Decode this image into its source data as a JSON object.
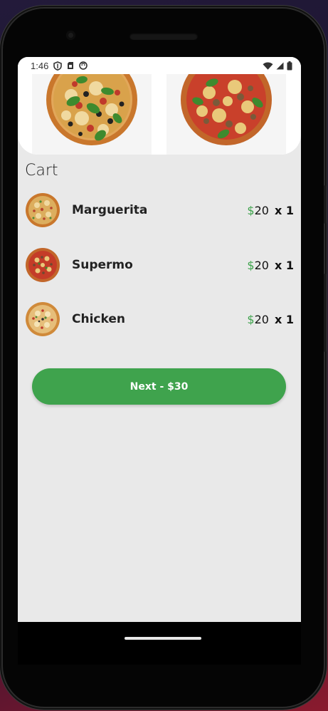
{
  "status_bar": {
    "time": "1:46"
  },
  "cart": {
    "title": "Cart",
    "items": [
      {
        "name": "Marguerita",
        "currency": "$",
        "price": "20",
        "quantity": "x 1"
      },
      {
        "name": "Supermo",
        "currency": "$",
        "price": "20",
        "quantity": "x 1"
      },
      {
        "name": "Chicken",
        "currency": "$",
        "price": "20",
        "quantity": "x 1"
      }
    ]
  },
  "checkout": {
    "next_label": "Next - $30"
  },
  "colors": {
    "accent": "#3fa34d",
    "screen_background": "#e9e9e9"
  }
}
